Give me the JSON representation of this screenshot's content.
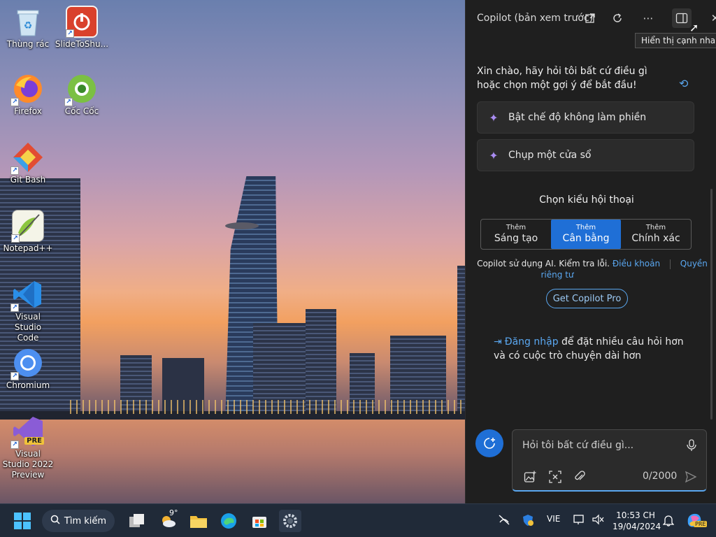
{
  "desktop": {
    "icons": [
      {
        "label": "Thùng rác"
      },
      {
        "label": "SlideToShu..."
      },
      {
        "label": "Firefox"
      },
      {
        "label": "Cốc Cốc"
      },
      {
        "label": "Git Bash"
      },
      {
        "label": "Notepad++"
      },
      {
        "label": "Visual Studio Code"
      },
      {
        "label": "Chromium"
      },
      {
        "label": "Visual Studio 2022 Preview",
        "badge": "PRE"
      }
    ]
  },
  "copilot": {
    "title": "Copilot (bản xem trước)",
    "tooltip": "Hiển thị cạnh nhau",
    "greeting": "Xin chào, hãy hỏi tôi bất cứ điều gì hoặc chọn một gợi ý để bắt đầu!",
    "suggestions": [
      {
        "label": "Bật chế độ không làm phiền"
      },
      {
        "label": "Chụp một cửa sổ"
      }
    ],
    "style_title": "Chọn kiểu hội thoại",
    "styles": [
      {
        "small": "Thêm",
        "big": "Sáng tạo"
      },
      {
        "small": "Thêm",
        "big": "Cân bằng"
      },
      {
        "small": "Thêm",
        "big": "Chính xác"
      }
    ],
    "notice_text": "Copilot sử dụng AI. Kiểm tra lỗi.",
    "notice_link_terms": "Điều khoản",
    "notice_link_privacy_1": "Quyền",
    "notice_link_privacy_2": "riêng tư",
    "pro_button": "Get Copilot Pro",
    "signin_link": "Đăng nhập",
    "signin_text": "để đặt nhiều câu hỏi hơn và có cuộc trò chuyện dài hơn",
    "input_placeholder": "Hỏi tôi bất cứ điều gì...",
    "char_counter": "0/2000",
    "accent": "#1f6fd6"
  },
  "taskbar": {
    "search_label": "Tìm kiếm",
    "weather_temp": "9°",
    "language": "VIE",
    "time": "10:53 CH",
    "date": "19/04/2024",
    "copilot_badge": "PRE"
  }
}
